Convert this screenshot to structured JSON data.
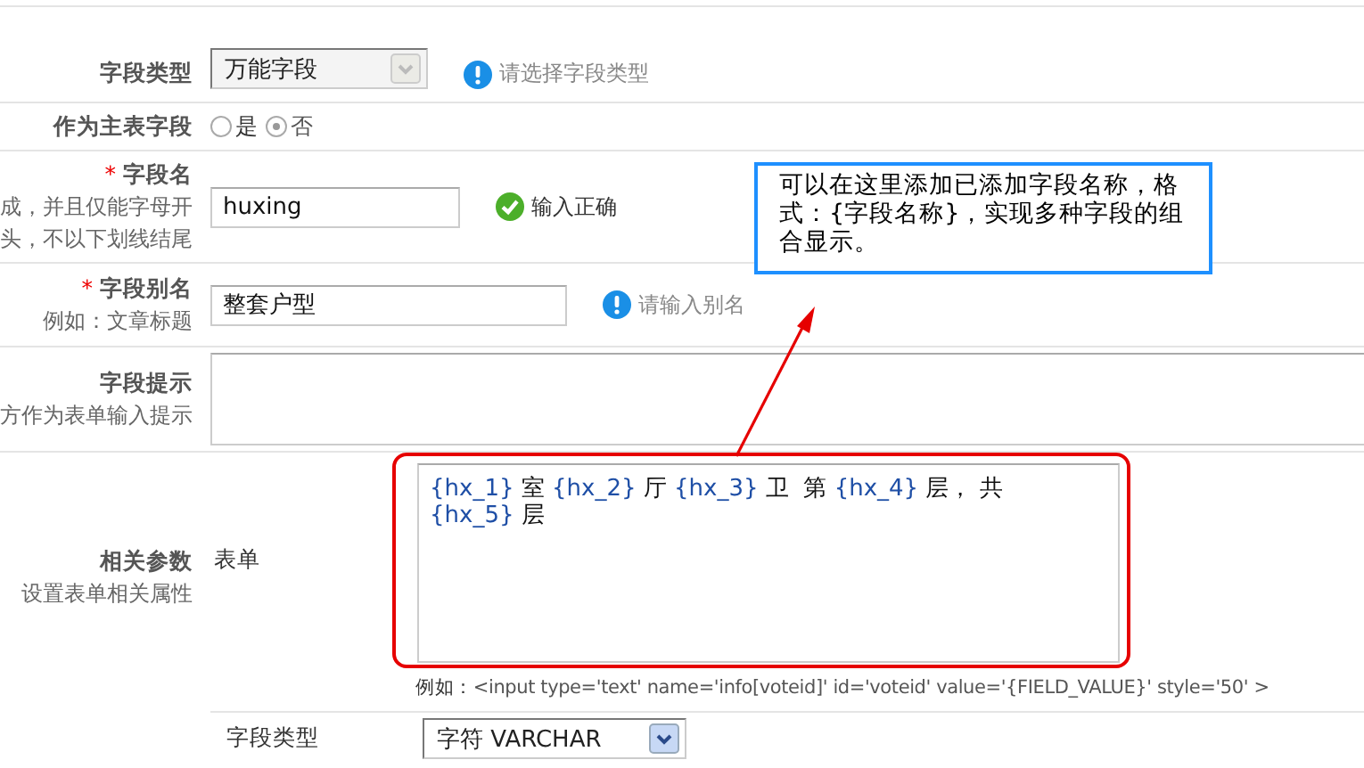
{
  "rows": [
    {
      "kind": "select",
      "label": "字段类型",
      "value": "万能字段",
      "disabled": true,
      "hint": {
        "kind": "info",
        "text": "请选择字段类型"
      }
    },
    {
      "kind": "radio",
      "label": "作为主表字段",
      "options": [
        {
          "label": "是",
          "selected": false
        },
        {
          "label": "否",
          "selected": true
        }
      ]
    },
    {
      "kind": "input",
      "label": "字段名",
      "required_mark": "*",
      "notes": [
        "成，并且仅能字母开",
        "头，不以下划线结尾"
      ],
      "value": "huxing",
      "wide": false,
      "hint": {
        "kind": "ok",
        "text": "输入正确"
      }
    },
    {
      "kind": "input",
      "label": "字段别名",
      "required_mark": "*",
      "notes": [
        "例如：文章标题"
      ],
      "value": "整套户型",
      "wide": true,
      "hint": {
        "kind": "info",
        "text": "请输入别名"
      }
    },
    {
      "kind": "textarea",
      "label": "字段提示",
      "notes": [
        "方作为表单输入提示"
      ]
    },
    {
      "kind": "params",
      "label": "相关参数",
      "notes": [
        "设置表单相关属性"
      ],
      "form_label": "表单",
      "form_parts": [
        {
          "kind": "token",
          "text": "{hx_1}"
        },
        {
          "kind": "text",
          "text": " 室 "
        },
        {
          "kind": "token",
          "text": "{hx_2}"
        },
        {
          "kind": "text",
          "text": " 厅 "
        },
        {
          "kind": "token",
          "text": "{hx_3}"
        },
        {
          "kind": "text",
          "text": " 卫  第 "
        },
        {
          "kind": "token",
          "text": "{hx_4}"
        },
        {
          "kind": "text",
          "text": " 层， 共 "
        },
        {
          "kind": "token",
          "text": "{hx_5}"
        },
        {
          "kind": "text",
          "text": " 层"
        }
      ],
      "example_label": "例如：",
      "example": "<input type='text' name='info[voteid]' id='voteid' value='{FIELD_VALUE}' style='50' >",
      "type_label": "字段类型",
      "type_value": "字符 VARCHAR",
      "type_disabled": false
    }
  ],
  "callout": {
    "text": "可以在这里添加已添加字段名称，格式：{字段名称}，实现多种字段的组合显示。"
  }
}
